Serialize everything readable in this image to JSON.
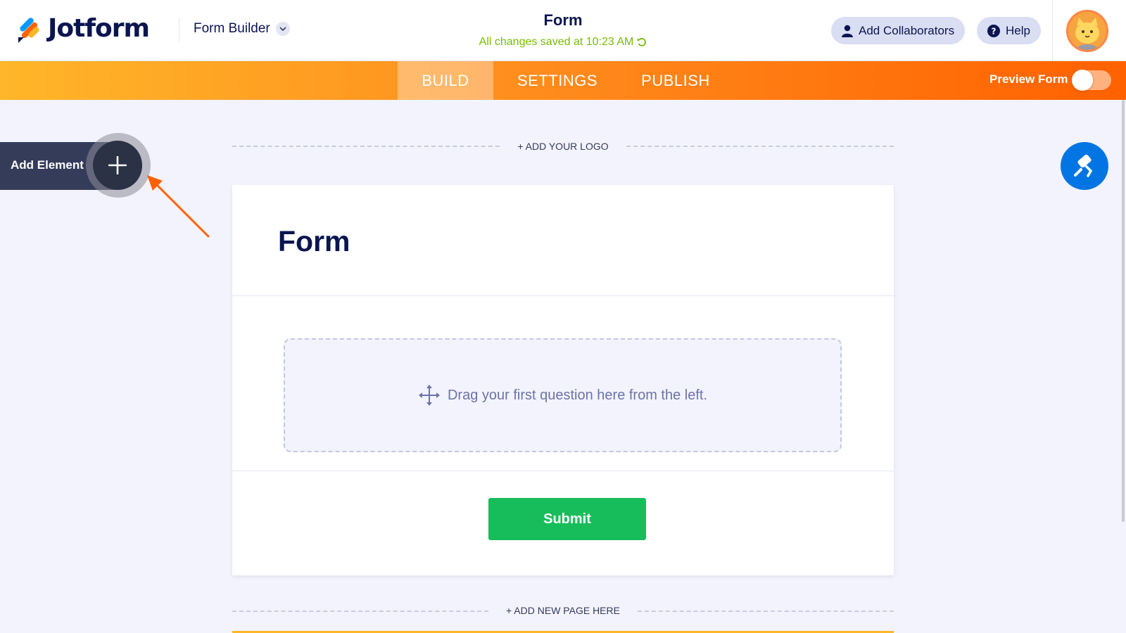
{
  "header": {
    "logo_text": "Jotform",
    "builder_label": "Form Builder",
    "form_title": "Form",
    "saved_status": "All changes saved at 10:23 AM",
    "add_collaborators": "Add Collaborators",
    "help": "Help"
  },
  "tabs": [
    {
      "label": "BUILD",
      "active": true
    },
    {
      "label": "SETTINGS",
      "active": false
    },
    {
      "label": "PUBLISH",
      "active": false
    }
  ],
  "preview": {
    "label": "Preview Form",
    "enabled": false
  },
  "sidebar": {
    "add_element_label": "Add Element"
  },
  "canvas": {
    "add_logo": "+ ADD YOUR LOGO",
    "form_heading": "Form",
    "drop_hint": "Drag your first question here from the left.",
    "submit_label": "Submit",
    "add_page": "+ ADD NEW PAGE HERE"
  },
  "colors": {
    "brand_navy": "#0a1551",
    "tab_orange": "#ff6100",
    "saved_green": "#78bb07",
    "submit_green": "#18bd5b",
    "fab_blue": "#0075e3"
  },
  "icons": {
    "logo": "jotform-logo-icon",
    "dropdown": "chevron-down-icon",
    "collaborators": "person-icon",
    "help": "question-circle-icon",
    "refresh": "refresh-icon",
    "add": "plus-icon",
    "move": "move-arrows-icon",
    "fab": "paint-roller-icon"
  }
}
